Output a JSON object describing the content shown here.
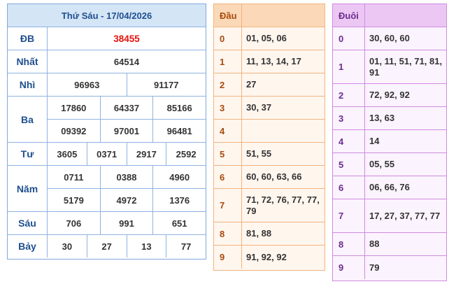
{
  "results": {
    "title": "Thứ Sáu - 17/04/2026",
    "special": {
      "label": "ĐB",
      "value": "38455"
    },
    "rows": [
      {
        "label": "Nhất",
        "lines": [
          [
            "64514"
          ]
        ]
      },
      {
        "label": "Nhì",
        "lines": [
          [
            "96963",
            "91177"
          ]
        ]
      },
      {
        "label": "Ba",
        "lines": [
          [
            "17860",
            "64337",
            "85166"
          ],
          [
            "09392",
            "97001",
            "96481"
          ]
        ]
      },
      {
        "label": "Tư",
        "lines": [
          [
            "3605",
            "0371",
            "2917",
            "2592"
          ]
        ]
      },
      {
        "label": "Năm",
        "lines": [
          [
            "0711",
            "0388",
            "4960"
          ],
          [
            "5179",
            "4972",
            "1376"
          ]
        ]
      },
      {
        "label": "Sáu",
        "lines": [
          [
            "706",
            "991",
            "651"
          ]
        ]
      },
      {
        "label": "Bảy",
        "lines": [
          [
            "30",
            "27",
            "13",
            "77"
          ]
        ]
      }
    ]
  },
  "dau": {
    "header": "Đầu",
    "rows": [
      {
        "key": "0",
        "value": "01, 05, 06"
      },
      {
        "key": "1",
        "value": "11, 13, 14, 17"
      },
      {
        "key": "2",
        "value": "27"
      },
      {
        "key": "3",
        "value": "30, 37"
      },
      {
        "key": "4",
        "value": ""
      },
      {
        "key": "5",
        "value": "51, 55"
      },
      {
        "key": "6",
        "value": "60, 60, 63, 66"
      },
      {
        "key": "7",
        "value": "71, 72, 76, 77, 77, 79"
      },
      {
        "key": "8",
        "value": "81, 88"
      },
      {
        "key": "9",
        "value": "91, 92, 92"
      }
    ]
  },
  "duoi": {
    "header": "Đuôi",
    "rows": [
      {
        "key": "0",
        "value": "30, 60, 60"
      },
      {
        "key": "1",
        "value": "01, 11, 51, 71, 81, 91"
      },
      {
        "key": "2",
        "value": "72, 92, 92"
      },
      {
        "key": "3",
        "value": "13, 63"
      },
      {
        "key": "4",
        "value": "14"
      },
      {
        "key": "5",
        "value": "05, 55"
      },
      {
        "key": "6",
        "value": "06, 66, 76"
      },
      {
        "key": "7",
        "value": "17, 27, 37, 77, 77"
      },
      {
        "key": "8",
        "value": "88"
      },
      {
        "key": "9",
        "value": "79"
      }
    ]
  }
}
